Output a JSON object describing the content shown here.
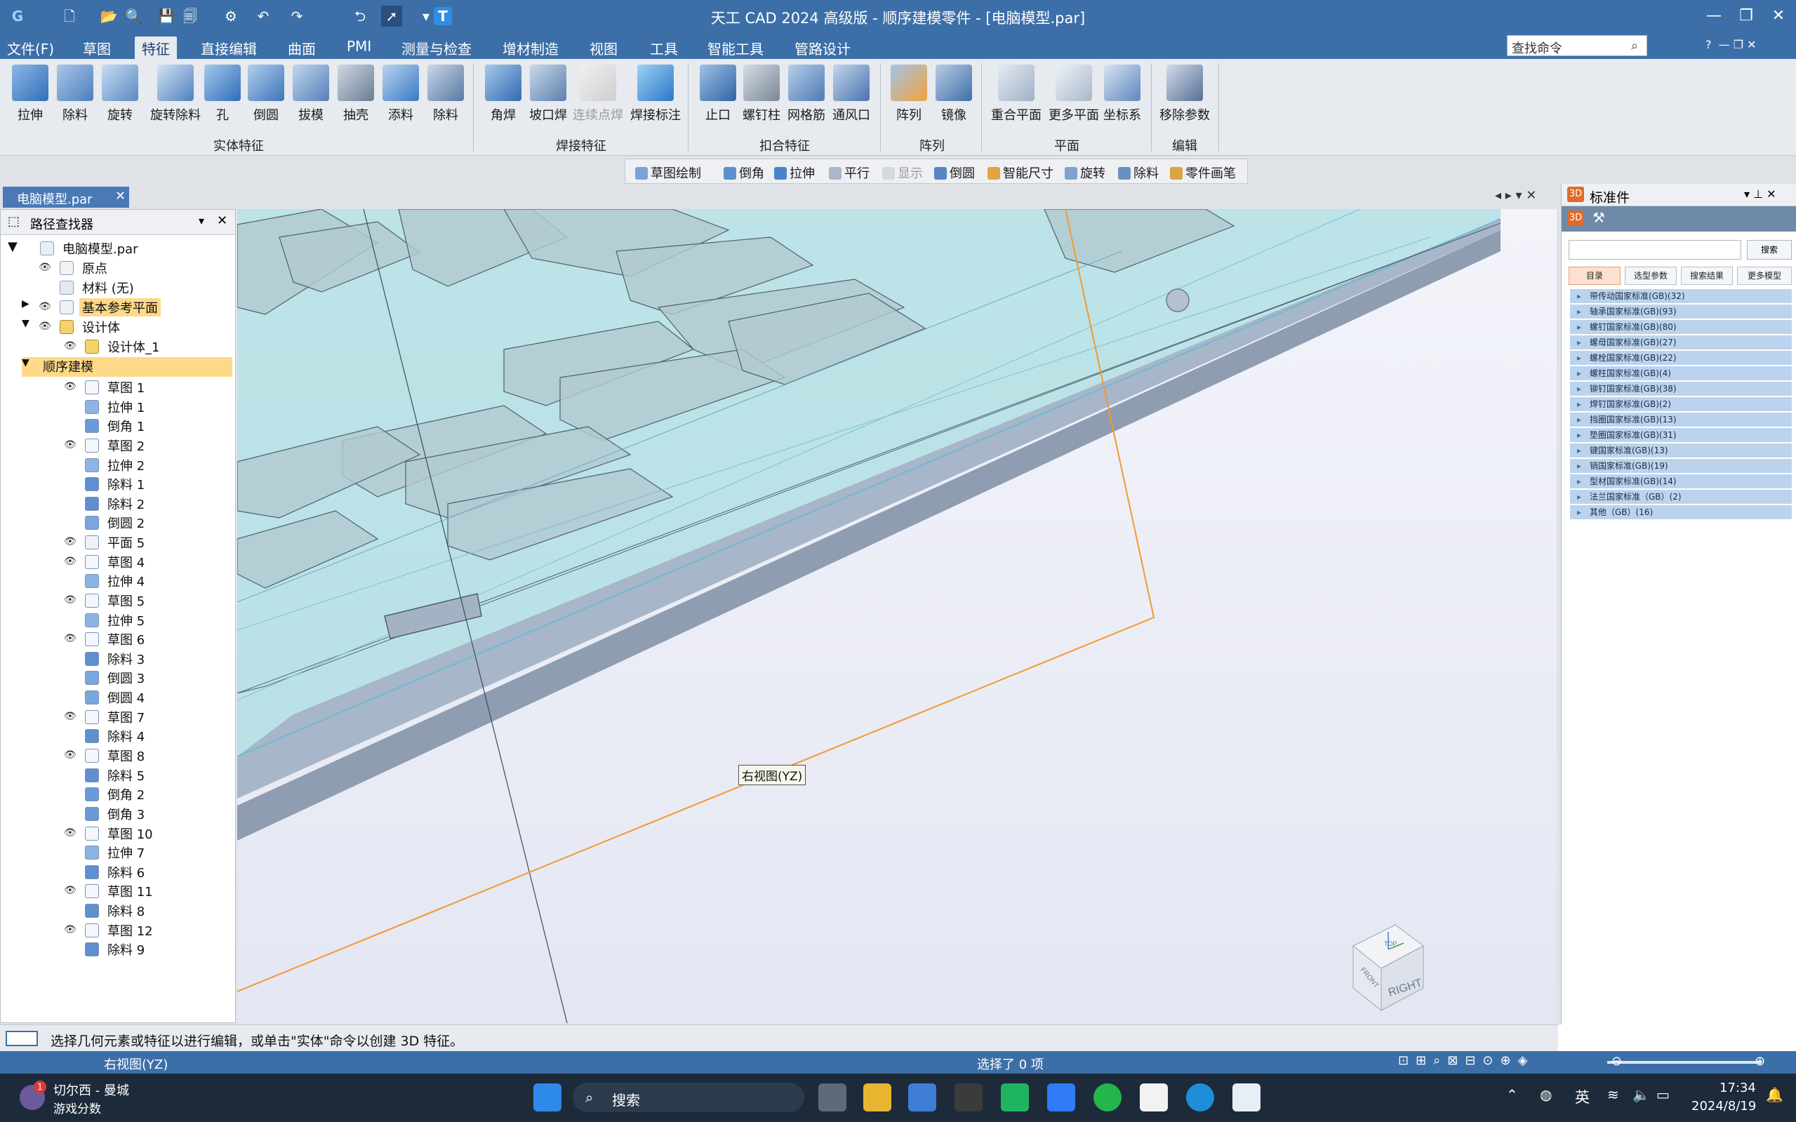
{
  "window": {
    "title": "天工 CAD 2024 高级版 - 顺序建模零件 - [电脑模型.par]"
  },
  "menus": [
    "文件(F)",
    "草图",
    "特征",
    "直接编辑",
    "曲面",
    "PMI",
    "测量与检查",
    "增材制造",
    "视图",
    "工具",
    "智能工具",
    "管路设计"
  ],
  "command_search": {
    "label": "查找命令"
  },
  "ribbon": {
    "solid_tools": [
      "拉伸",
      "除料",
      "旋转",
      "旋转除料",
      "孔",
      "倒圆",
      "拔模",
      "抽壳",
      "添料",
      "除料"
    ],
    "solid_group": "实体特征",
    "weld_tools": [
      "角焊",
      "坡口焊",
      "连续点焊",
      "焊接标注"
    ],
    "weld_group": "焊接特征",
    "snap_tools": [
      "止口",
      "螺钉柱",
      "网格筋",
      "通风口"
    ],
    "snap_group": "扣合特征",
    "pattern_tools": [
      "阵列",
      "镜像"
    ],
    "pattern_group": "阵列",
    "plane_tools": [
      "重合平面",
      "更多平面",
      "坐标系"
    ],
    "plane_group": "平面",
    "edit_tools": [
      "移除参数"
    ],
    "edit_group": "编辑"
  },
  "sub_toolbar": [
    "草图绘制",
    "倒角",
    "拉伸",
    "平行",
    "显示",
    "倒圆",
    "智能尺寸",
    "旋转",
    "除料",
    "零件画笔"
  ],
  "doc_tab": "电脑模型.par",
  "pathfinder": {
    "title": "路径查找器",
    "root": "电脑模型.par",
    "origin": "原点",
    "material": "材料 (无)",
    "base_planes": "基本参考平面",
    "design_body": "设计体",
    "design_body_1": "设计体_1",
    "ordered": "顺序建模",
    "features": [
      {
        "label": "草图 1",
        "eye": true,
        "kind": "sketch"
      },
      {
        "label": "拉伸 1",
        "eye": false,
        "kind": "extrude"
      },
      {
        "label": "倒角 1",
        "eye": false,
        "kind": "chamfer"
      },
      {
        "label": "草图 2",
        "eye": true,
        "kind": "sketch"
      },
      {
        "label": "拉伸 2",
        "eye": false,
        "kind": "extrude"
      },
      {
        "label": "除料 1",
        "eye": false,
        "kind": "cut"
      },
      {
        "label": "除料 2",
        "eye": false,
        "kind": "cut"
      },
      {
        "label": "倒圆 2",
        "eye": false,
        "kind": "round"
      },
      {
        "label": "平面 5",
        "eye": true,
        "kind": "plane"
      },
      {
        "label": "草图 4",
        "eye": true,
        "kind": "sketch"
      },
      {
        "label": "拉伸 4",
        "eye": false,
        "kind": "extrude"
      },
      {
        "label": "草图 5",
        "eye": true,
        "kind": "sketch"
      },
      {
        "label": "拉伸 5",
        "eye": false,
        "kind": "extrude"
      },
      {
        "label": "草图 6",
        "eye": true,
        "kind": "sketch"
      },
      {
        "label": "除料 3",
        "eye": false,
        "kind": "cut"
      },
      {
        "label": "倒圆 3",
        "eye": false,
        "kind": "round"
      },
      {
        "label": "倒圆 4",
        "eye": false,
        "kind": "round"
      },
      {
        "label": "草图 7",
        "eye": true,
        "kind": "sketch"
      },
      {
        "label": "除料 4",
        "eye": false,
        "kind": "cut"
      },
      {
        "label": "草图 8",
        "eye": true,
        "kind": "sketch"
      },
      {
        "label": "除料 5",
        "eye": false,
        "kind": "cut"
      },
      {
        "label": "倒角 2",
        "eye": false,
        "kind": "chamfer"
      },
      {
        "label": "倒角 3",
        "eye": false,
        "kind": "chamfer"
      },
      {
        "label": "草图 10",
        "eye": true,
        "kind": "sketch"
      },
      {
        "label": "拉伸 7",
        "eye": false,
        "kind": "extrude"
      },
      {
        "label": "除料 6",
        "eye": false,
        "kind": "cut"
      },
      {
        "label": "草图 11",
        "eye": true,
        "kind": "sketch"
      },
      {
        "label": "除料 8",
        "eye": false,
        "kind": "cut"
      },
      {
        "label": "草图 12",
        "eye": true,
        "kind": "sketch"
      },
      {
        "label": "除料 9",
        "eye": false,
        "kind": "cut"
      }
    ]
  },
  "viewport": {
    "plane_label": "右视图(YZ)",
    "view_cube": [
      "RIGHT",
      "FRONT",
      "TOP"
    ]
  },
  "standard_parts": {
    "title": "标准件",
    "search_button": "搜索",
    "tabs": [
      "目录",
      "选型参数",
      "搜索结果",
      "更多模型"
    ],
    "categories": [
      "带传动国家标准(GB)(32)",
      "轴承国家标准(GB)(93)",
      "螺钉国家标准(GB)(80)",
      "螺母国家标准(GB)(27)",
      "螺栓国家标准(GB)(22)",
      "螺柱国家标准(GB)(4)",
      "铆钉国家标准(GB)(38)",
      "焊钉国家标准(GB)(2)",
      "挡圈国家标准(GB)(13)",
      "垫圈国家标准(GB)(31)",
      "键国家标准(GB)(13)",
      "销国家标准(GB)(19)",
      "型材国家标准(GB)(14)",
      "法兰国家标准（GB）(2)",
      "其他（GB）(16)"
    ]
  },
  "status": {
    "prompt": "选择几何元素或特征以进行编辑，或单击\"实体\"命令以创建 3D 特征。",
    "view": "右视图(YZ)",
    "selection": "选择了 0 项"
  },
  "taskbar": {
    "media_title": "切尔西 - 曼城",
    "media_sub": "游戏分数",
    "badge": "1",
    "search": "搜索",
    "ime": "英",
    "time": "17:34",
    "date": "2024/8/19"
  },
  "colors": {
    "title_bg": "#3c6fa8",
    "viewport_bg": "#eceef7",
    "model_cyan": "#a9dde0",
    "highlight": "#ffd98a",
    "sketch_orange": "#f29a2e"
  }
}
